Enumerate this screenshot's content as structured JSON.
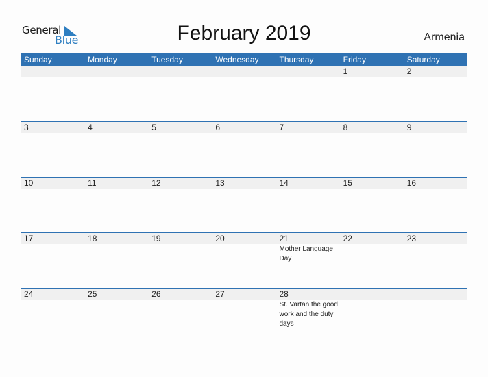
{
  "logo": {
    "text_top": "General",
    "text_bottom": "Blue",
    "icon": "triangle-flag-icon"
  },
  "title": "February 2019",
  "country": "Armenia",
  "colors": {
    "header_bg": "#2f72b3",
    "row_bg": "#f0f0f0",
    "logo_blue": "#2f7fc1"
  },
  "weekdays": [
    "Sunday",
    "Monday",
    "Tuesday",
    "Wednesday",
    "Thursday",
    "Friday",
    "Saturday"
  ],
  "weeks": [
    [
      {
        "day": ""
      },
      {
        "day": ""
      },
      {
        "day": ""
      },
      {
        "day": ""
      },
      {
        "day": ""
      },
      {
        "day": "1"
      },
      {
        "day": "2"
      }
    ],
    [
      {
        "day": "3"
      },
      {
        "day": "4"
      },
      {
        "day": "5"
      },
      {
        "day": "6"
      },
      {
        "day": "7"
      },
      {
        "day": "8"
      },
      {
        "day": "9"
      }
    ],
    [
      {
        "day": "10"
      },
      {
        "day": "11"
      },
      {
        "day": "12"
      },
      {
        "day": "13"
      },
      {
        "day": "14"
      },
      {
        "day": "15"
      },
      {
        "day": "16"
      }
    ],
    [
      {
        "day": "17"
      },
      {
        "day": "18"
      },
      {
        "day": "19"
      },
      {
        "day": "20"
      },
      {
        "day": "21",
        "event": "Mother Language Day"
      },
      {
        "day": "22"
      },
      {
        "day": "23"
      }
    ],
    [
      {
        "day": "24"
      },
      {
        "day": "25"
      },
      {
        "day": "26"
      },
      {
        "day": "27"
      },
      {
        "day": "28",
        "event": "St. Vartan the good work and the duty days"
      },
      {
        "day": ""
      },
      {
        "day": ""
      }
    ]
  ]
}
